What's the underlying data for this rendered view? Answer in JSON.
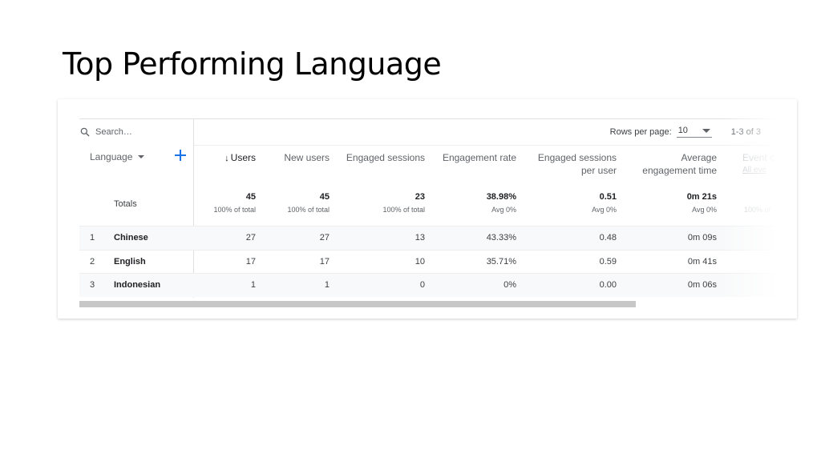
{
  "slide": {
    "title": "Top Performing Language"
  },
  "search": {
    "placeholder": "Search…"
  },
  "pagination": {
    "rows_label": "Rows per page:",
    "rows_value": "10",
    "range": "1-3 of 3"
  },
  "dimension": {
    "label": "Language"
  },
  "columns": [
    {
      "label": "Users",
      "sub": "",
      "sorted": true
    },
    {
      "label": "New users",
      "sub": ""
    },
    {
      "label": "Engaged sessions",
      "sub": ""
    },
    {
      "label": "Engagement rate",
      "sub": ""
    },
    {
      "label": "Engaged sessions",
      "sub": "per user"
    },
    {
      "label": "Average",
      "sub": "engagement time"
    },
    {
      "label": "Event c",
      "sub": "All eve"
    }
  ],
  "totals": {
    "label": "Totals",
    "values": [
      "45",
      "45",
      "23",
      "38.98%",
      "0.51",
      "0m 21s",
      ""
    ],
    "subs": [
      "100% of total",
      "100% of total",
      "100% of total",
      "Avg 0%",
      "Avg 0%",
      "Avg 0%",
      "100% of"
    ]
  },
  "rows": [
    {
      "num": "1",
      "language": "Chinese",
      "values": [
        "27",
        "27",
        "13",
        "43.33%",
        "0.48",
        "0m 09s"
      ]
    },
    {
      "num": "2",
      "language": "English",
      "values": [
        "17",
        "17",
        "10",
        "35.71%",
        "0.59",
        "0m 41s"
      ]
    },
    {
      "num": "3",
      "language": "Indonesian",
      "values": [
        "1",
        "1",
        "0",
        "0%",
        "0.00",
        "0m 06s"
      ]
    }
  ],
  "icons": {
    "search": "search-icon",
    "add": "add-dimension-icon",
    "sort": "sort-down-arrow-icon"
  },
  "colors": {
    "accent": "#1a73e8",
    "scrollbar": "#c7c7c7",
    "title": "#000000"
  }
}
